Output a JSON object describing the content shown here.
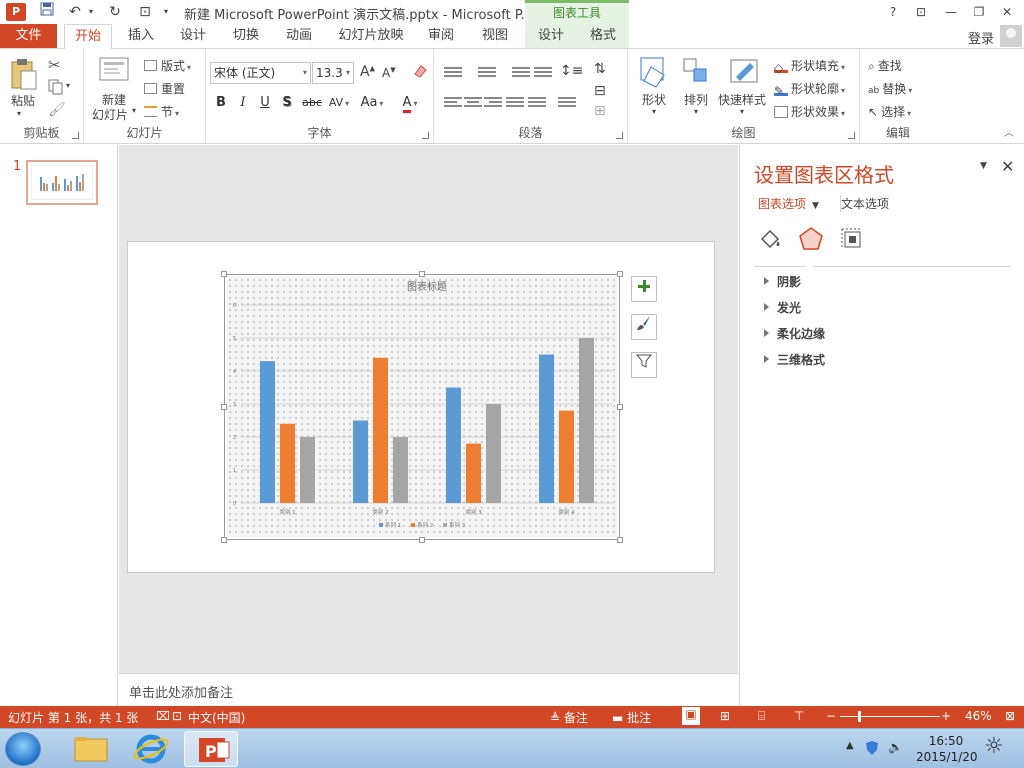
{
  "titlebar": {
    "app_icon": "P",
    "title": "新建 Microsoft PowerPoint 演示文稿.pptx - Microsoft P...",
    "contextual_group": "图表工具",
    "help": "?"
  },
  "tabs": {
    "file": "文件",
    "items": [
      "开始",
      "插入",
      "设计",
      "切换",
      "动画",
      "幻灯片放映",
      "审阅",
      "视图",
      "设计",
      "格式"
    ],
    "active": "开始",
    "login": "登录"
  },
  "ribbon": {
    "clipboard": {
      "label": "剪贴板",
      "paste": "粘贴"
    },
    "slides": {
      "label": "幻灯片",
      "new_slide_1": "新建",
      "new_slide_2": "幻灯片",
      "layout": "版式",
      "reset": "重置",
      "section": "节"
    },
    "font": {
      "label": "字体",
      "font_name": "宋体 (正文)",
      "font_size": "13.3",
      "bold": "B",
      "italic": "I",
      "underline": "U",
      "shadow": "S",
      "strike": "abc",
      "spacing": "AV",
      "case": "Aa",
      "color": "A",
      "grow": "A",
      "shrink": "A"
    },
    "paragraph": {
      "label": "段落"
    },
    "drawing": {
      "label": "绘图",
      "shapes": "形状",
      "arrange": "排列",
      "quick_styles": "快速样式",
      "fill": "形状填充",
      "outline": "形状轮廓",
      "effects": "形状效果"
    },
    "editing": {
      "label": "编辑",
      "find": "查找",
      "replace": "替换",
      "select": "选择"
    }
  },
  "thumbnails": {
    "slide_number": "1"
  },
  "chart_data": {
    "type": "bar",
    "title": "图表标题",
    "categories": [
      "类别 1",
      "类别 2",
      "类别 3",
      "类别 4"
    ],
    "series": [
      {
        "name": "系列 1",
        "values": [
          4.3,
          2.5,
          3.5,
          4.5
        ],
        "color": "#5b9bd5"
      },
      {
        "name": "系列 2",
        "values": [
          2.4,
          4.4,
          1.8,
          2.8
        ],
        "color": "#ed7d31"
      },
      {
        "name": "系列 3",
        "values": [
          2.0,
          2.0,
          3.0,
          5.0
        ],
        "color": "#a5a5a5"
      }
    ],
    "ylim": [
      0,
      6
    ],
    "yticks": [
      "0",
      "1",
      "2",
      "3",
      "4",
      "5",
      "6"
    ],
    "grid": true,
    "legend": "bottom",
    "background": "dotted pattern"
  },
  "chart_buttons": {
    "add_element": "chart-elements",
    "styles": "chart-styles",
    "filter": "chart-filters"
  },
  "notes": {
    "placeholder": "单击此处添加备注"
  },
  "format_pane": {
    "title": "设置图表区格式",
    "tab_chart": "图表选项",
    "tab_text": "文本选项",
    "sections": [
      "阴影",
      "发光",
      "柔化边缘",
      "三维格式"
    ],
    "accent": "#d24726"
  },
  "status": {
    "slide_info": "幻灯片 第 1 张，共 1 张",
    "language": "中文(中国)",
    "notes": "备注",
    "comments": "批注",
    "zoom": "46%"
  },
  "taskbar": {
    "time": "16:50",
    "date": "2015/1/20"
  }
}
